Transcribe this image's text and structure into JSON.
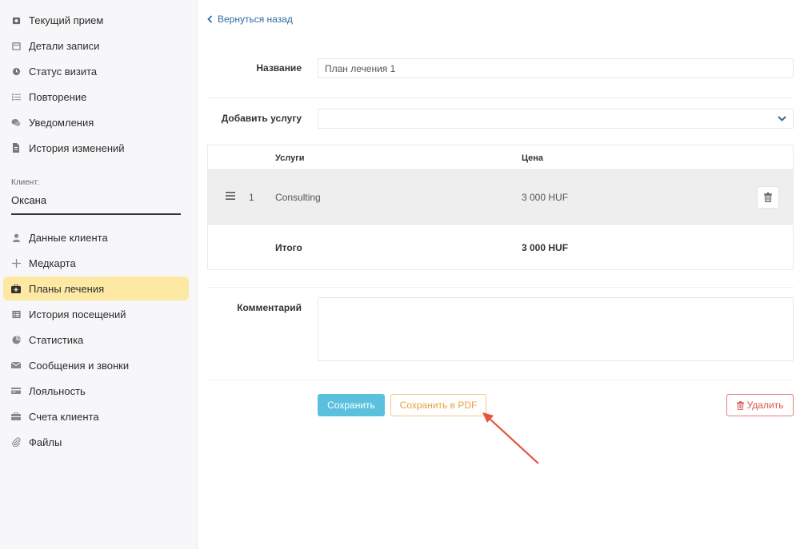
{
  "sidebar": {
    "items_top": [
      {
        "label": "Текущий прием",
        "icon": "camera-icon"
      },
      {
        "label": "Детали записи",
        "icon": "calendar-icon"
      },
      {
        "label": "Статус визита",
        "icon": "clock-icon"
      },
      {
        "label": "Повторение",
        "icon": "list-icon"
      },
      {
        "label": "Уведомления",
        "icon": "chat-icon"
      },
      {
        "label": "История изменений",
        "icon": "document-icon"
      }
    ],
    "client_label": "Клиент:",
    "client_name": "Оксана",
    "items_bottom": [
      {
        "label": "Данные клиента",
        "icon": "user-icon"
      },
      {
        "label": "Медкарта",
        "icon": "plus-icon"
      },
      {
        "label": "Планы лечения",
        "icon": "medkit-icon",
        "active": true
      },
      {
        "label": "История посещений",
        "icon": "table-icon"
      },
      {
        "label": "Статистика",
        "icon": "pie-chart-icon"
      },
      {
        "label": "Сообщения и звонки",
        "icon": "envelope-icon"
      },
      {
        "label": "Лояльность",
        "icon": "card-icon"
      },
      {
        "label": "Счета клиента",
        "icon": "briefcase-icon"
      },
      {
        "label": "Файлы",
        "icon": "paperclip-icon"
      }
    ]
  },
  "main": {
    "back_label": "Вернуться назад",
    "name_label": "Название",
    "name_value": "План лечения 1",
    "add_service_label": "Добавить услугу",
    "add_service_value": "",
    "table": {
      "col_services": "Услуги",
      "col_price": "Цена",
      "rows": [
        {
          "num": "1",
          "service": "Consulting",
          "price": "3 000 HUF"
        }
      ],
      "total_label": "Итого",
      "total_value": "3 000 HUF"
    },
    "comment_label": "Комментарий",
    "comment_value": "",
    "buttons": {
      "save": "Сохранить",
      "save_pdf": "Сохранить в PDF",
      "delete": "Удалить"
    }
  },
  "colors": {
    "active_bg": "#fde9a4",
    "link": "#2e6da4",
    "save_bg": "#5bc0de",
    "pdf_border": "#f3c98d",
    "pdf_text": "#e8a23f",
    "delete": "#d9534f",
    "arrow": "#e5533a"
  }
}
